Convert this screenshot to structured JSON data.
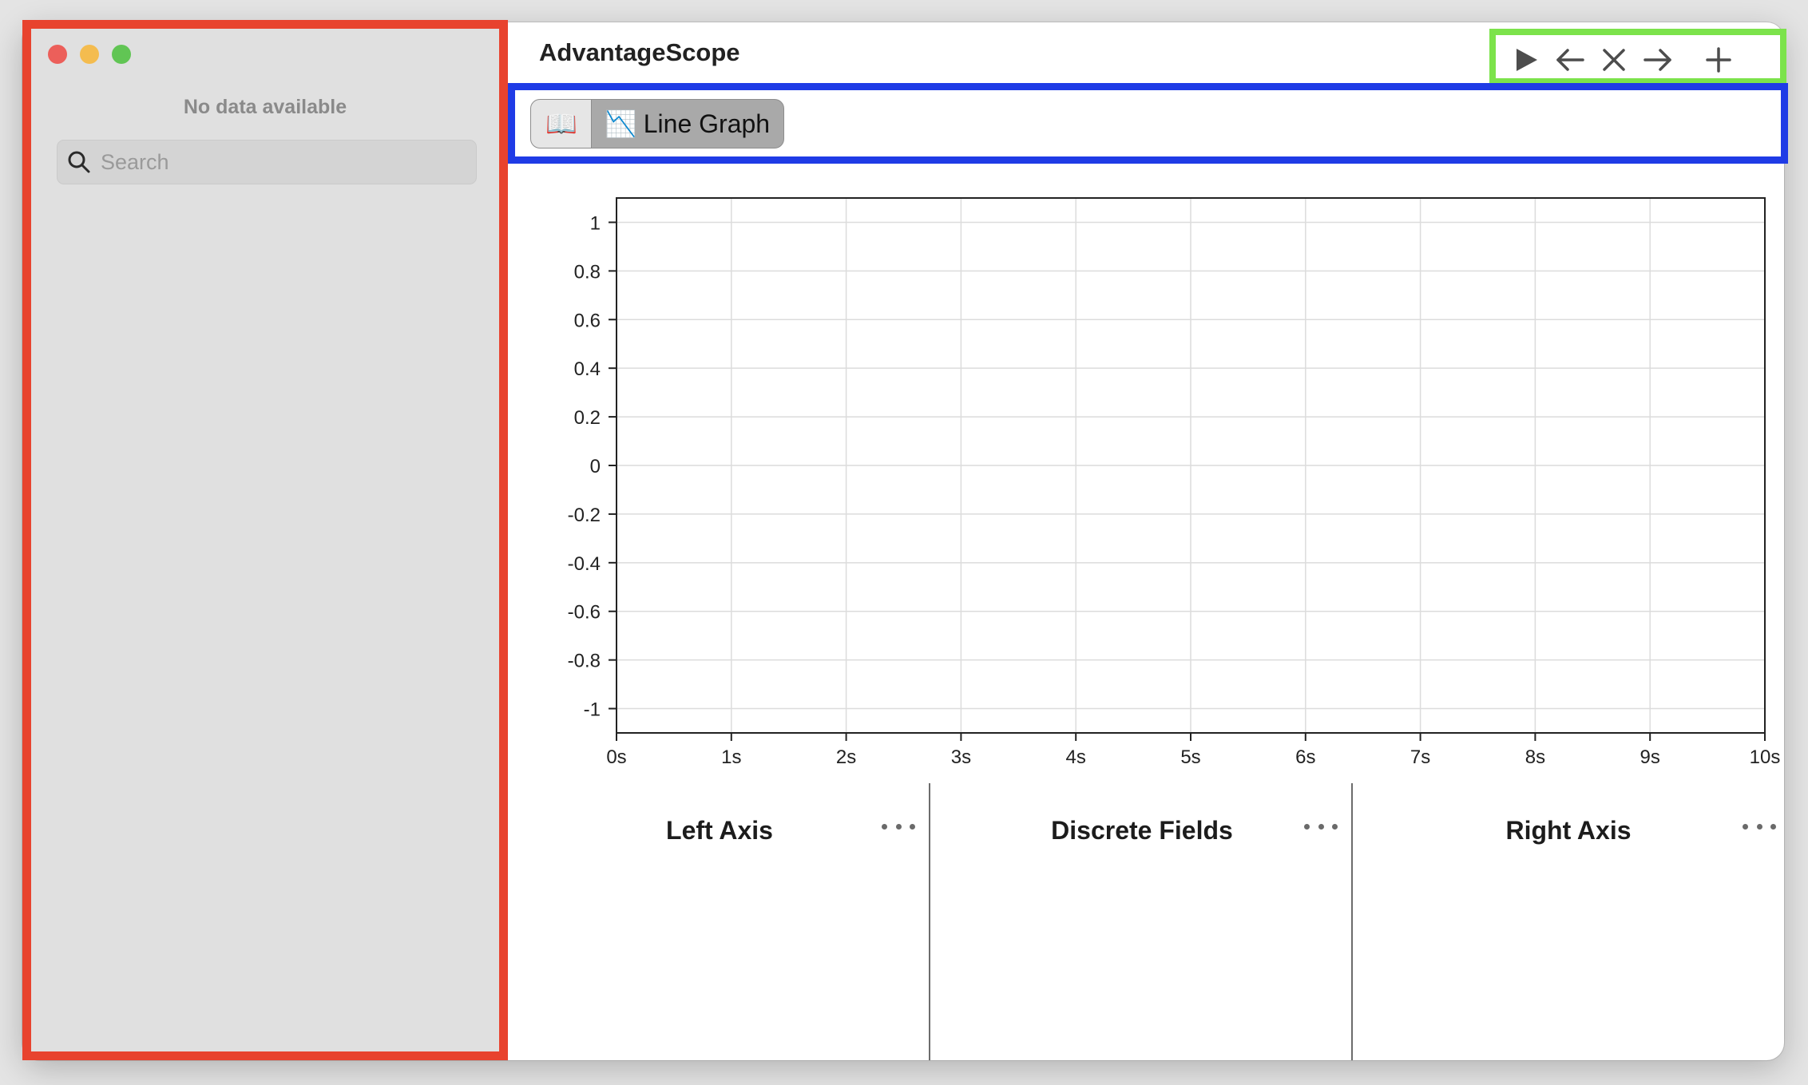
{
  "app": {
    "title": "AdvantageScope"
  },
  "sidebar": {
    "status_text": "No data available",
    "search": {
      "placeholder": "Search",
      "value": ""
    }
  },
  "toolbar": {
    "buttons": [
      "play-icon",
      "arrow-left-icon",
      "close-icon",
      "arrow-right-icon",
      "plus-icon"
    ]
  },
  "tabs": [
    {
      "label": "",
      "icon": "📖",
      "name": "documentation",
      "selected": false
    },
    {
      "label": "Line Graph",
      "icon": "📉",
      "name": "line-graph",
      "selected": true
    }
  ],
  "chart_data": {
    "type": "line",
    "title": "",
    "xlabel": "",
    "ylabel": "",
    "x_ticks": [
      "0s",
      "1s",
      "2s",
      "3s",
      "4s",
      "5s",
      "6s",
      "7s",
      "8s",
      "9s",
      "10s"
    ],
    "y_ticks": [
      "1",
      "0.8",
      "0.6",
      "0.4",
      "0.2",
      "0",
      "-0.2",
      "-0.4",
      "-0.6",
      "-0.8",
      "-1"
    ],
    "xlim": [
      0,
      10
    ],
    "ylim": [
      -1.1,
      1.1
    ],
    "grid": true,
    "series": []
  },
  "panels": [
    {
      "title": "Left Axis"
    },
    {
      "title": "Discrete Fields"
    },
    {
      "title": "Right Axis"
    }
  ],
  "colors": {
    "highlight_sidebar": "#e8432e",
    "highlight_toolbar": "#7ce34b",
    "highlight_tabs": "#1f3be6"
  }
}
